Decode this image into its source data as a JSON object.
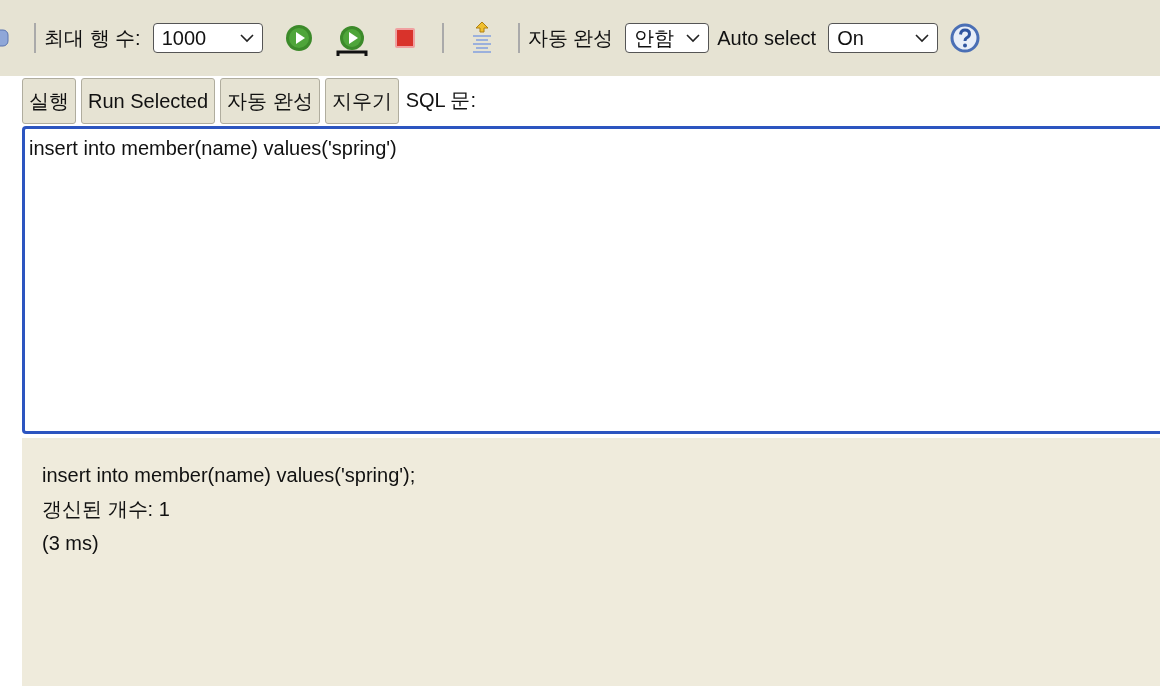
{
  "toolbar": {
    "items": [
      {
        "kind": "icon"
      },
      {
        "kind": "separator"
      },
      {
        "kind": "label",
        "text": "최대 행 수:"
      },
      {
        "kind": "select",
        "value": "1000"
      },
      {
        "kind": "icon"
      },
      {
        "kind": "icon"
      },
      {
        "kind": "icon"
      },
      {
        "kind": "separator"
      },
      {
        "kind": "icon"
      },
      {
        "kind": "separator"
      },
      {
        "kind": "label",
        "text": "자동 완성"
      },
      {
        "kind": "select",
        "value": "안함"
      },
      {
        "kind": "label",
        "text": "Auto select"
      },
      {
        "kind": "select",
        "value": "On"
      },
      {
        "kind": "icon"
      }
    ]
  },
  "buttons": [
    "실행",
    "Run Selected",
    "자동 완성",
    "지우기"
  ],
  "editor_label": "SQL 문:",
  "editor": {
    "value": "insert into member(name) values('spring')",
    "focused": true
  },
  "result": {
    "lines": [
      "insert into member(name) values('spring');",
      "갱신된 개수: 1",
      "(3 ms)"
    ]
  }
}
